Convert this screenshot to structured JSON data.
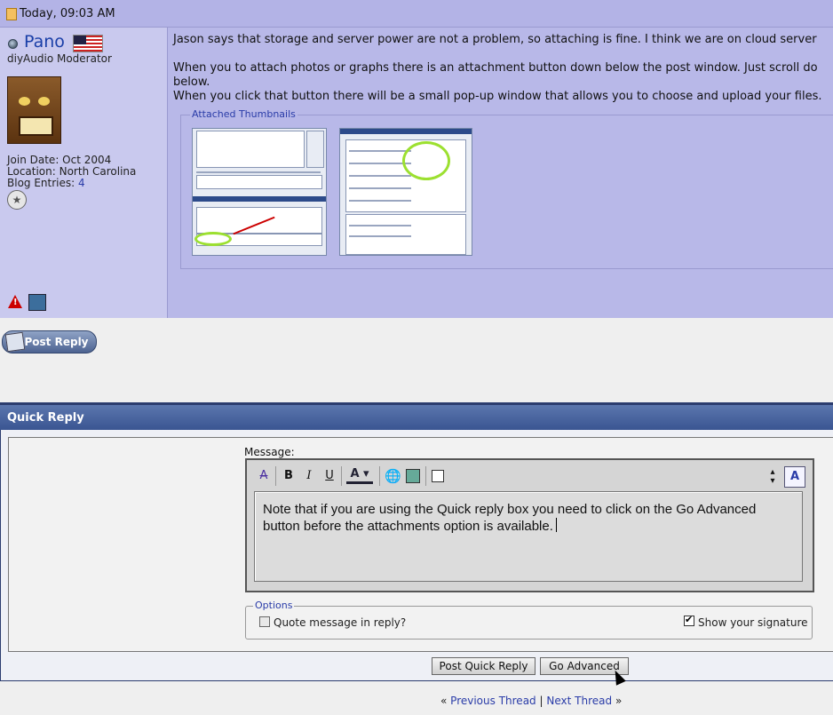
{
  "post": {
    "date": "Today, 09:03 AM",
    "user": {
      "name": "Pano",
      "title": "diyAudio Moderator",
      "join_date": "Join Date: Oct 2004",
      "location": "Location: North Carolina",
      "blog_entries_label": "Blog Entries:",
      "blog_entries_count": "4"
    },
    "message_lines": [
      "Jason says that storage and server power are not a problem, so attaching is fine. I think we are on cloud server",
      "",
      "When you to attach photos or graphs there is an attachment button down below the post window. Just scroll do",
      "below.",
      "When you click that button there will be a small pop-up window that allows you to choose and upload your files."
    ],
    "attachments_legend": "Attached Thumbnails"
  },
  "post_reply_button": "Post Reply",
  "quick_reply": {
    "title": "Quick Reply",
    "message_label": "Message:",
    "editor_text": "Note that if you are using the Quick reply box you need to  click on the Go Advanced button before the attachments option is available.",
    "options_legend": "Options",
    "quote_label": "Quote message in reply?",
    "quote_checked": false,
    "signature_label": "Show your signature",
    "signature_checked": true,
    "post_button": "Post Quick Reply",
    "advanced_button": "Go Advanced"
  },
  "thread_nav": {
    "prev": "Previous Thread",
    "separator": "|",
    "next": "Next Thread",
    "left_arrows": "«",
    "right_arrows": "»"
  },
  "colors": {
    "post_bg": "#b8b8e8",
    "user_bg": "#c9c9ee",
    "header_blue": "#3a5592",
    "link": "#2a3ca8",
    "highlight_green": "#9ce030"
  }
}
